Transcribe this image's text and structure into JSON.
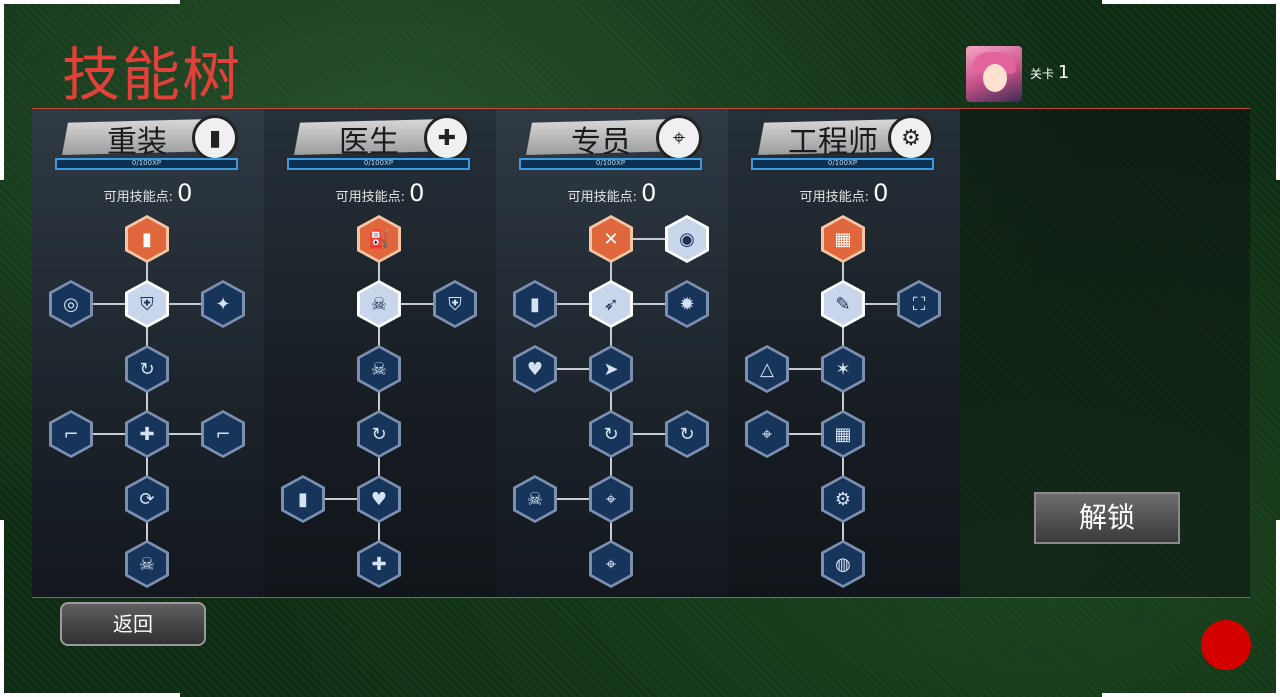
{
  "title": "技能树",
  "level": {
    "label": "关卡",
    "value": "1"
  },
  "columns": [
    {
      "name": "重装",
      "icon": "ammo-icon",
      "icon_glyph": "▮",
      "xp": "0/100XP",
      "points_label": "可用技能点:",
      "points": "0"
    },
    {
      "name": "医生",
      "icon": "medical-cross-icon",
      "icon_glyph": "✚",
      "xp": "0/100XP",
      "points_label": "可用技能点:",
      "points": "0"
    },
    {
      "name": "专员",
      "icon": "crosshair-icon",
      "icon_glyph": "⌖",
      "xp": "0/100XP",
      "points_label": "可用技能点:",
      "points": "0"
    },
    {
      "name": "工程师",
      "icon": "gear-wrench-icon",
      "icon_glyph": "⚙",
      "xp": "0/100XP",
      "points_label": "可用技能点:",
      "points": "0"
    }
  ],
  "skill_nodes": [
    [
      {
        "id": "heavy-ammo-plus",
        "state": "orange",
        "glyph": "▮"
      },
      {
        "id": "heavy-grenades",
        "state": "locked",
        "glyph": "◎"
      },
      {
        "id": "heavy-shield",
        "state": "white",
        "glyph": "⛨"
      },
      {
        "id": "heavy-wrench-gun",
        "state": "locked",
        "glyph": "✦"
      },
      {
        "id": "heavy-reload",
        "state": "locked",
        "glyph": "↻"
      },
      {
        "id": "heavy-rifle",
        "state": "locked",
        "glyph": "⌐"
      },
      {
        "id": "heavy-gun-plus",
        "state": "locked",
        "glyph": "✚"
      },
      {
        "id": "heavy-pistol",
        "state": "locked",
        "glyph": "⌐"
      },
      {
        "id": "heavy-ammo-cycle",
        "state": "locked",
        "glyph": "⟳"
      },
      {
        "id": "heavy-skull",
        "state": "locked",
        "glyph": "☠"
      }
    ],
    [
      {
        "id": "medic-pump",
        "state": "orange",
        "glyph": "⛽"
      },
      {
        "id": "medic-skull-cross",
        "state": "white",
        "glyph": "☠"
      },
      {
        "id": "medic-shield",
        "state": "locked",
        "glyph": "⛨"
      },
      {
        "id": "medic-skull-heart",
        "state": "locked",
        "glyph": "☠"
      },
      {
        "id": "medic-reload",
        "state": "locked",
        "glyph": "↻"
      },
      {
        "id": "medic-ammo",
        "state": "locked",
        "glyph": "▮"
      },
      {
        "id": "medic-heart",
        "state": "locked",
        "glyph": "♥"
      },
      {
        "id": "medic-shield-cross",
        "state": "locked",
        "glyph": "✚"
      }
    ],
    [
      {
        "id": "agent-crossed-guns",
        "state": "orange",
        "glyph": "✕"
      },
      {
        "id": "agent-grenade",
        "state": "white",
        "glyph": "◉"
      },
      {
        "id": "agent-ammo-plus",
        "state": "locked",
        "glyph": "▮"
      },
      {
        "id": "agent-rocket",
        "state": "white",
        "glyph": "➶"
      },
      {
        "id": "agent-explosion",
        "state": "locked",
        "glyph": "✹"
      },
      {
        "id": "agent-heart-plus",
        "state": "locked",
        "glyph": "♥"
      },
      {
        "id": "agent-runner",
        "state": "locked",
        "glyph": "➤"
      },
      {
        "id": "agent-reload-bolt",
        "state": "locked",
        "glyph": "↻"
      },
      {
        "id": "agent-reload",
        "state": "locked",
        "glyph": "↻"
      },
      {
        "id": "agent-skull-hand",
        "state": "locked",
        "glyph": "☠"
      },
      {
        "id": "agent-skull-target",
        "state": "locked",
        "glyph": "⌖"
      },
      {
        "id": "agent-skull-target-2",
        "state": "locked",
        "glyph": "⌖"
      }
    ],
    [
      {
        "id": "eng-building",
        "state": "orange",
        "glyph": "▦"
      },
      {
        "id": "eng-wrench",
        "state": "white",
        "glyph": "✎"
      },
      {
        "id": "eng-turret",
        "state": "locked",
        "glyph": "⛶"
      },
      {
        "id": "eng-tent",
        "state": "locked",
        "glyph": "△"
      },
      {
        "id": "eng-turret-spark",
        "state": "locked",
        "glyph": "✶"
      },
      {
        "id": "eng-telescope",
        "state": "locked",
        "glyph": "⌖"
      },
      {
        "id": "eng-building-up",
        "state": "locked",
        "glyph": "▦"
      },
      {
        "id": "eng-building-gear",
        "state": "locked",
        "glyph": "⚙"
      },
      {
        "id": "eng-tank",
        "state": "locked",
        "glyph": "◍"
      }
    ]
  ],
  "buttons": {
    "unlock": "解锁",
    "back": "返回"
  }
}
